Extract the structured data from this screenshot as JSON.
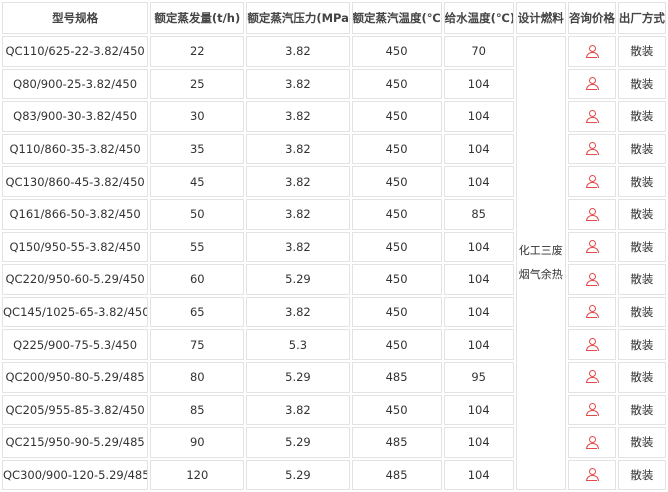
{
  "headers": {
    "model": "型号规格",
    "capacity": "额定蒸发量(t/h)",
    "pressure": "额定蒸汽压力(MPa)",
    "temperature": "额定蒸汽温度(℃)",
    "feedwater": "给水温度(℃)",
    "fuel": "设计燃料",
    "inquiry": "咨询价格",
    "delivery": "出厂方式"
  },
  "fuel_lines": [
    "化工三废",
    "烟气余热"
  ],
  "icon": "person-icon",
  "accent_color": "#e24b4b",
  "rows": [
    {
      "model": "QC110/625-22-3.82/450",
      "capacity": "22",
      "pressure": "3.82",
      "temperature": "450",
      "feedwater": "70",
      "delivery": "散装"
    },
    {
      "model": "Q80/900-25-3.82/450",
      "capacity": "25",
      "pressure": "3.82",
      "temperature": "450",
      "feedwater": "104",
      "delivery": "散装"
    },
    {
      "model": "Q83/900-30-3.82/450",
      "capacity": "30",
      "pressure": "3.82",
      "temperature": "450",
      "feedwater": "104",
      "delivery": "散装"
    },
    {
      "model": "Q110/860-35-3.82/450",
      "capacity": "35",
      "pressure": "3.82",
      "temperature": "450",
      "feedwater": "104",
      "delivery": "散装"
    },
    {
      "model": "QC130/860-45-3.82/450",
      "capacity": "45",
      "pressure": "3.82",
      "temperature": "450",
      "feedwater": "104",
      "delivery": "散装"
    },
    {
      "model": "Q161/866-50-3.82/450",
      "capacity": "50",
      "pressure": "3.82",
      "temperature": "450",
      "feedwater": "85",
      "delivery": "散装"
    },
    {
      "model": "Q150/950-55-3.82/450",
      "capacity": "55",
      "pressure": "3.82",
      "temperature": "450",
      "feedwater": "104",
      "delivery": "散装"
    },
    {
      "model": "QC220/950-60-5.29/450",
      "capacity": "60",
      "pressure": "5.29",
      "temperature": "450",
      "feedwater": "104",
      "delivery": "散装"
    },
    {
      "model": "QC145/1025-65-3.82/450",
      "capacity": "65",
      "pressure": "3.82",
      "temperature": "450",
      "feedwater": "104",
      "delivery": "散装"
    },
    {
      "model": "Q225/900-75-5.3/450",
      "capacity": "75",
      "pressure": "5.3",
      "temperature": "450",
      "feedwater": "104",
      "delivery": "散装"
    },
    {
      "model": "QC200/950-80-5.29/485",
      "capacity": "80",
      "pressure": "5.29",
      "temperature": "485",
      "feedwater": "95",
      "delivery": "散装"
    },
    {
      "model": "QC205/955-85-3.82/450",
      "capacity": "85",
      "pressure": "3.82",
      "temperature": "450",
      "feedwater": "104",
      "delivery": "散装"
    },
    {
      "model": "QC215/950-90-5.29/485",
      "capacity": "90",
      "pressure": "5.29",
      "temperature": "485",
      "feedwater": "104",
      "delivery": "散装"
    },
    {
      "model": "QC300/900-120-5.29/485",
      "capacity": "120",
      "pressure": "5.29",
      "temperature": "485",
      "feedwater": "104",
      "delivery": "散装"
    }
  ]
}
